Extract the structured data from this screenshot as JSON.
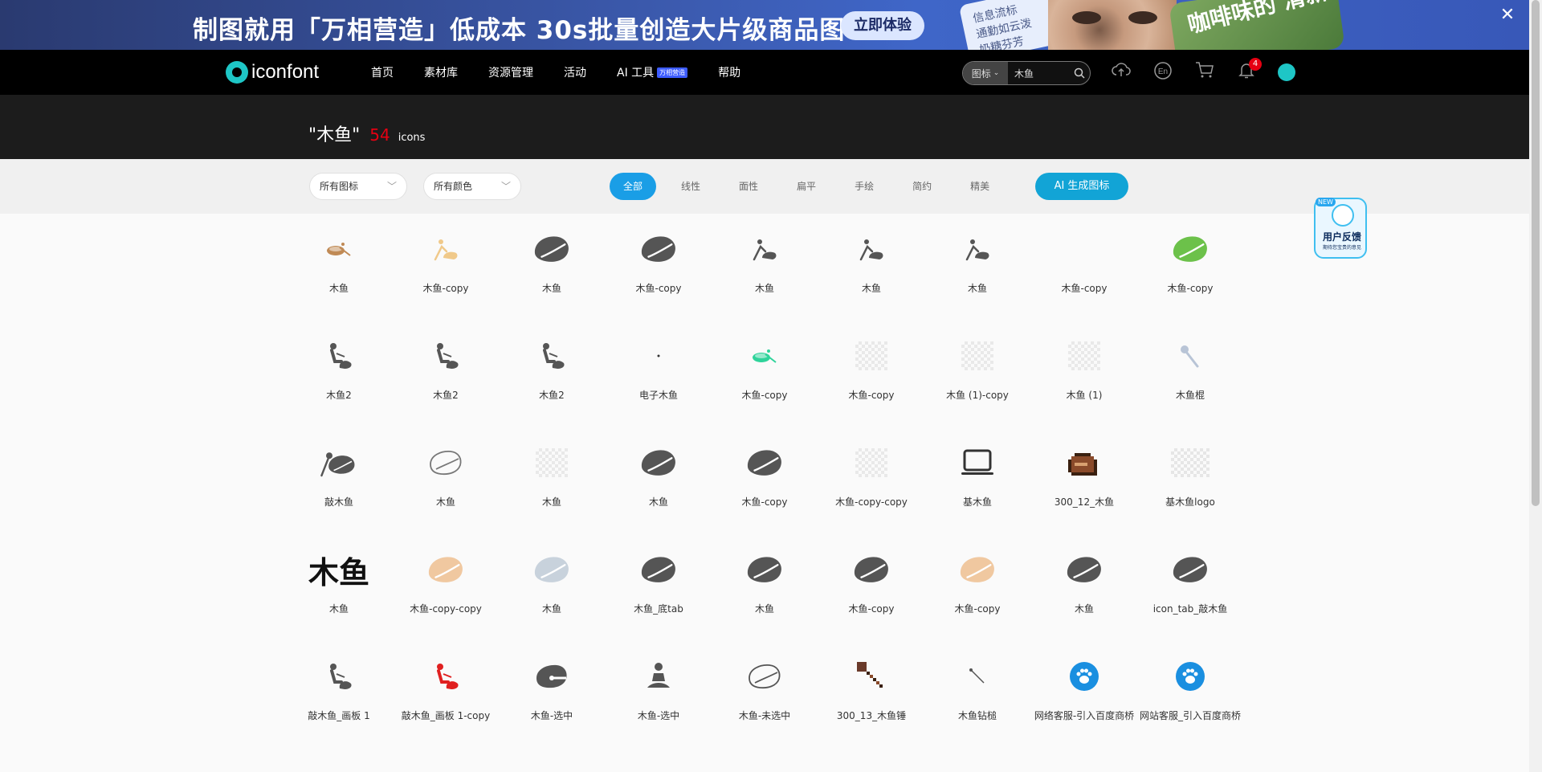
{
  "banner": {
    "text": "制图就用「万相营造」低成本 30s批量创造大片级商品图",
    "cta": "立即体验",
    "card_lines": [
      "信息流标",
      "通勤如云泼",
      "奶糖芬芳"
    ],
    "photo2_text": "咖啡味的 清新"
  },
  "nav": {
    "logo": "iconfont",
    "menu": [
      "首页",
      "素材库",
      "资源管理",
      "活动",
      "AI 工具",
      "帮助"
    ],
    "ai_badge": "万相营造",
    "search_type": "图标",
    "search_value": "木鱼",
    "bell_count": "4",
    "lang_icon": "En"
  },
  "title": {
    "query": "\"木鱼\"",
    "count": "54",
    "unit": "icons"
  },
  "filters": {
    "icon_select": "所有图标",
    "color_select": "所有颜色",
    "tabs": [
      "全部",
      "线性",
      "面性",
      "扁平",
      "手绘",
      "简约",
      "精美"
    ],
    "ai_button": "AI 生成图标"
  },
  "feedback": {
    "badge": "NEW",
    "title": "用户反馈",
    "subtitle": "期待您宝贵的意见"
  },
  "icons": [
    {
      "label": "木鱼",
      "icon": "wooden-fish-bowl-icon",
      "color": "#c08a55"
    },
    {
      "label": "木鱼-copy",
      "icon": "person-striking-icon",
      "color": "#f0c98a"
    },
    {
      "label": "木鱼",
      "icon": "wooden-fish-icon",
      "color": "#555555"
    },
    {
      "label": "木鱼-copy",
      "icon": "wooden-fish-icon",
      "color": "#555555"
    },
    {
      "label": "木鱼",
      "icon": "person-striking-icon",
      "color": "#555555"
    },
    {
      "label": "木鱼",
      "icon": "person-striking-icon",
      "color": "#555555"
    },
    {
      "label": "木鱼",
      "icon": "person-striking-icon",
      "color": "#555555"
    },
    {
      "label": "木鱼-copy",
      "icon": "blank-icon",
      "color": "#ffffff"
    },
    {
      "label": "木鱼-copy",
      "icon": "wooden-fish-icon",
      "color": "#6cc14a"
    },
    {
      "label": "木鱼2",
      "icon": "person-seated-icon",
      "color": "#555555"
    },
    {
      "label": "木鱼2",
      "icon": "person-seated-icon",
      "color": "#555555"
    },
    {
      "label": "木鱼2",
      "icon": "person-seated-icon",
      "color": "#555555"
    },
    {
      "label": "电子木鱼",
      "icon": "dot-icon",
      "color": "#333333"
    },
    {
      "label": "木鱼-copy",
      "icon": "wooden-fish-bowl-icon",
      "color": "#2ed39a"
    },
    {
      "label": "木鱼-copy",
      "icon": "transparent-placeholder-icon",
      "color": "#e6e6e6"
    },
    {
      "label": "木鱼 (1)-copy",
      "icon": "transparent-placeholder-icon",
      "color": "#e6e6e6"
    },
    {
      "label": "木鱼 (1)",
      "icon": "transparent-placeholder-icon",
      "color": "#e6e6e6"
    },
    {
      "label": "木鱼棍",
      "icon": "mallet-icon",
      "color": "#b8c4d6"
    },
    {
      "label": "敲木鱼",
      "icon": "wooden-fish-mallet-icon",
      "color": "#555555"
    },
    {
      "label": "木鱼",
      "icon": "wooden-fish-outline-icon",
      "color": "#777777"
    },
    {
      "label": "木鱼",
      "icon": "transparent-placeholder-icon",
      "color": "#eeeeee"
    },
    {
      "label": "木鱼",
      "icon": "wooden-fish-icon",
      "color": "#555555"
    },
    {
      "label": "木鱼-copy",
      "icon": "wooden-fish-icon",
      "color": "#555555"
    },
    {
      "label": "木鱼-copy-copy",
      "icon": "transparent-placeholder-icon",
      "color": "#eeeeee"
    },
    {
      "label": "基木鱼",
      "icon": "laptop-icon",
      "color": "#333333"
    },
    {
      "label": "300_12_木鱼",
      "icon": "pixel-fish-icon",
      "color": "#8a4a2a"
    },
    {
      "label": "基木鱼logo",
      "icon": "transparent-wide-icon",
      "color": "#eeeeee"
    },
    {
      "label": "木鱼",
      "icon": "text-muyu-icon",
      "color": "#111111"
    },
    {
      "label": "木鱼-copy-copy",
      "icon": "wooden-fish-icon",
      "color": "#f0c8a0"
    },
    {
      "label": "木鱼",
      "icon": "wooden-fish-icon",
      "color": "#c8d2dc"
    },
    {
      "label": "木鱼_底tab",
      "icon": "wooden-fish-icon",
      "color": "#555555"
    },
    {
      "label": "木鱼",
      "icon": "wooden-fish-icon",
      "color": "#555555"
    },
    {
      "label": "木鱼-copy",
      "icon": "wooden-fish-icon",
      "color": "#555555"
    },
    {
      "label": "木鱼-copy",
      "icon": "wooden-fish-icon",
      "color": "#f0c8a0"
    },
    {
      "label": "木鱼",
      "icon": "wooden-fish-icon",
      "color": "#555555"
    },
    {
      "label": "icon_tab_敲木鱼",
      "icon": "wooden-fish-icon",
      "color": "#555555"
    },
    {
      "label": "敲木鱼_画板 1",
      "icon": "person-seated-icon",
      "color": "#555555"
    },
    {
      "label": "敲木鱼_画板 1-copy",
      "icon": "person-seated-icon",
      "color": "#e02020"
    },
    {
      "label": "木鱼-选中",
      "icon": "wooden-fish-selected-icon",
      "color": "#555555"
    },
    {
      "label": "木鱼-选中",
      "icon": "meditating-person-icon",
      "color": "#555555"
    },
    {
      "label": "木鱼-未选中",
      "icon": "wooden-fish-outline-icon",
      "color": "#555555"
    },
    {
      "label": "300_13_木鱼锤",
      "icon": "pixel-mallet-icon",
      "color": "#6a3a2a"
    },
    {
      "label": "木鱼钻槌",
      "icon": "stick-icon",
      "color": "#555555"
    },
    {
      "label": "网络客服-引入百度商桥",
      "icon": "paw-circle-icon",
      "color": "#1a8fe0"
    },
    {
      "label": "网站客服_引入百度商桥",
      "icon": "paw-circle-icon",
      "color": "#1a8fe0"
    }
  ]
}
